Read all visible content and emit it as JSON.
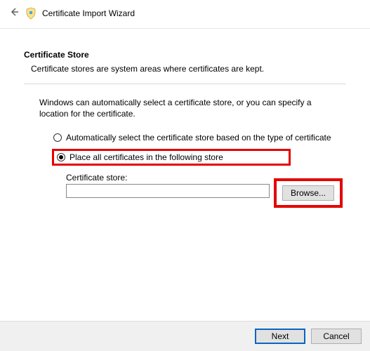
{
  "header": {
    "title": "Certificate Import Wizard"
  },
  "section": {
    "heading": "Certificate Store",
    "sub": "Certificate stores are system areas where certificates are kept."
  },
  "body": {
    "intro": "Windows can automatically select a certificate store, or you can specify a location for the certificate."
  },
  "radios": {
    "auto": "Automatically select the certificate store based on the type of certificate",
    "place": "Place all certificates in the following store",
    "selected": "place"
  },
  "store": {
    "label": "Certificate store:",
    "value": "",
    "browse": "Browse..."
  },
  "footer": {
    "next": "Next",
    "cancel": "Cancel"
  }
}
